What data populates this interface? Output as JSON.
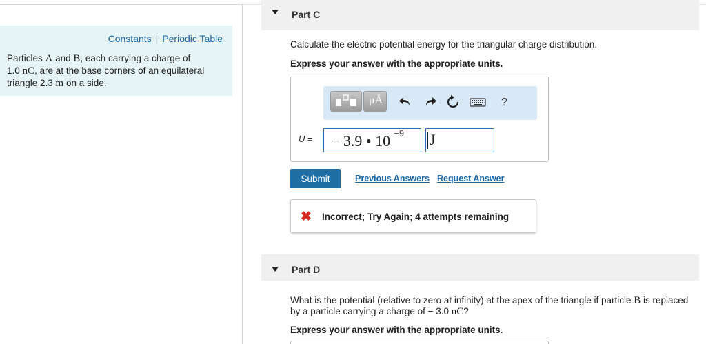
{
  "info": {
    "constants_link": "Constants",
    "separator": "|",
    "periodic_link": "Periodic Table",
    "problem": {
      "t1": "Particles ",
      "a": "A",
      "t2": " and ",
      "b": "B",
      "t3": ", each carrying a charge of",
      "t4": "1.0 ",
      "unit_nc": "nC",
      "t5": ", are at the base corners of an equilateral",
      "t6": "triangle 2.3 ",
      "unit_m": "m",
      "t7": " on a side."
    }
  },
  "part_c": {
    "title": "Part C",
    "question": "Calculate the electric potential energy for the triangular charge distribution.",
    "instruction": "Express your answer with the appropriate units.",
    "toolbar": {
      "units_button": "μÅ",
      "help": "?"
    },
    "answer": {
      "variable": "U",
      "equals": "=",
      "value": "− 3.9 • 10",
      "exponent": "−9",
      "unit": "J"
    },
    "submit_label": "Submit",
    "previous_answers": "Previous Answers",
    "request_answer": "Request Answer",
    "feedback": {
      "icon": "✖",
      "message": "Incorrect; Try Again; 4 attempts remaining"
    }
  },
  "part_d": {
    "title": "Part D",
    "q1": "What is the potential (relative to zero at infinity) at the apex of the triangle if particle ",
    "b": "B",
    "q2": " is replaced",
    "q3": "by a particle carrying a charge of − 3.0 ",
    "unit_nc": "nC",
    "q4": "?",
    "instruction": "Express your answer with the appropriate units."
  },
  "colors": {
    "info_bg": "#e6f4f6",
    "link": "#1a67a8",
    "toolbar_bg": "#d9e8f6",
    "submit_bg": "#1f6ea6",
    "error": "#d52a1f"
  }
}
